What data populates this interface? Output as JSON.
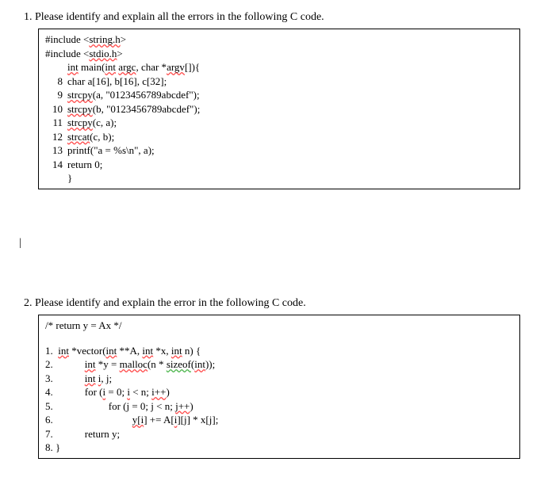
{
  "q1": {
    "prompt": "1. Please identify and explain all the errors in the following C code.",
    "lines": {
      "inc1a": "#include <",
      "inc1b": "string.h",
      "inc1c": ">",
      "inc2a": "#include <",
      "inc2b": "stdio.h",
      "inc2c": ">",
      "main_a": "int",
      "main_b": " main(",
      "main_c": "int",
      "main_d": " ",
      "main_e": "argc",
      "main_f": ", char *",
      "main_g": "argv",
      "main_h": "[]){",
      "l8": "char a[16], b[16], c[32];",
      "l9a": "strcpy",
      "l9b": "(a, \"0123456789abcdef\");",
      "l10a": "strcpy",
      "l10b": "(b, \"0123456789abcdef\");",
      "l11a": "strcpy",
      "l11b": "(c, a);",
      "l12a": "strcat",
      "l12b": "(c, b);",
      "l13": "printf(\"a = %s\\n\", a);",
      "l14": "return 0;",
      "close": "}"
    }
  },
  "cursor": "|",
  "q2": {
    "prompt": "2. Please identify and explain the error in the following C code.",
    "comment": "/* return y = Ax */",
    "lines": {
      "l1a": "1.  ",
      "l1b": "int",
      "l1c": " *vector(",
      "l1d": "int",
      "l1e": " **A, ",
      "l1f": "int",
      "l1g": " *x, ",
      "l1h": "int",
      "l1i": " n) {",
      "l2a": "2.",
      "l2b": "int",
      "l2c": " *y = ",
      "l2d": "malloc",
      "l2e": "(n * ",
      "l2f": "sizeof",
      "l2g": "(",
      "l2h": "int",
      "l2i": "));",
      "l3a": "3.",
      "l3b": "int",
      "l3c": " ",
      "l3d": "i",
      "l3e": ", j;",
      "l4a": "4.",
      "l4b": "for (",
      "l4c": "i",
      "l4d": " = 0; ",
      "l4e": "i",
      "l4f": " < n; ",
      "l4g": "i++",
      "l4h": ")",
      "l5a": "5.",
      "l5b": "for (j = 0; j < n; ",
      "l5c": "j++",
      "l5d": ")",
      "l6a": "6.",
      "l6b": "y[i",
      "l6c": "] += A[",
      "l6d": "i",
      "l6e": "][j] * x[j];",
      "l7a": "7.",
      "l7b": "return y;",
      "l8": "8. }"
    }
  }
}
